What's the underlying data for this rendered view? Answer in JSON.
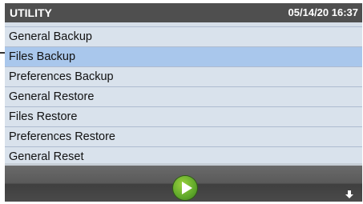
{
  "header": {
    "title": "UTILITY",
    "datetime": "05/14/20 16:37"
  },
  "menu": {
    "items": [
      {
        "label": "General Backup",
        "selected": false
      },
      {
        "label": "Files Backup",
        "selected": true
      },
      {
        "label": "Preferences Backup",
        "selected": false
      },
      {
        "label": "General Restore",
        "selected": false
      },
      {
        "label": "Files Restore",
        "selected": false
      },
      {
        "label": "Preferences Restore",
        "selected": false
      },
      {
        "label": "General Reset",
        "selected": false
      }
    ]
  },
  "footer": {
    "play_icon": "play-icon",
    "scroll_icon": "arrow-down-icon"
  },
  "colors": {
    "header_bg": "#4f4f4f",
    "menu_bg": "#d9e2ec",
    "selected_bg": "#a9c7ec",
    "play_green": "#5fa82a"
  }
}
